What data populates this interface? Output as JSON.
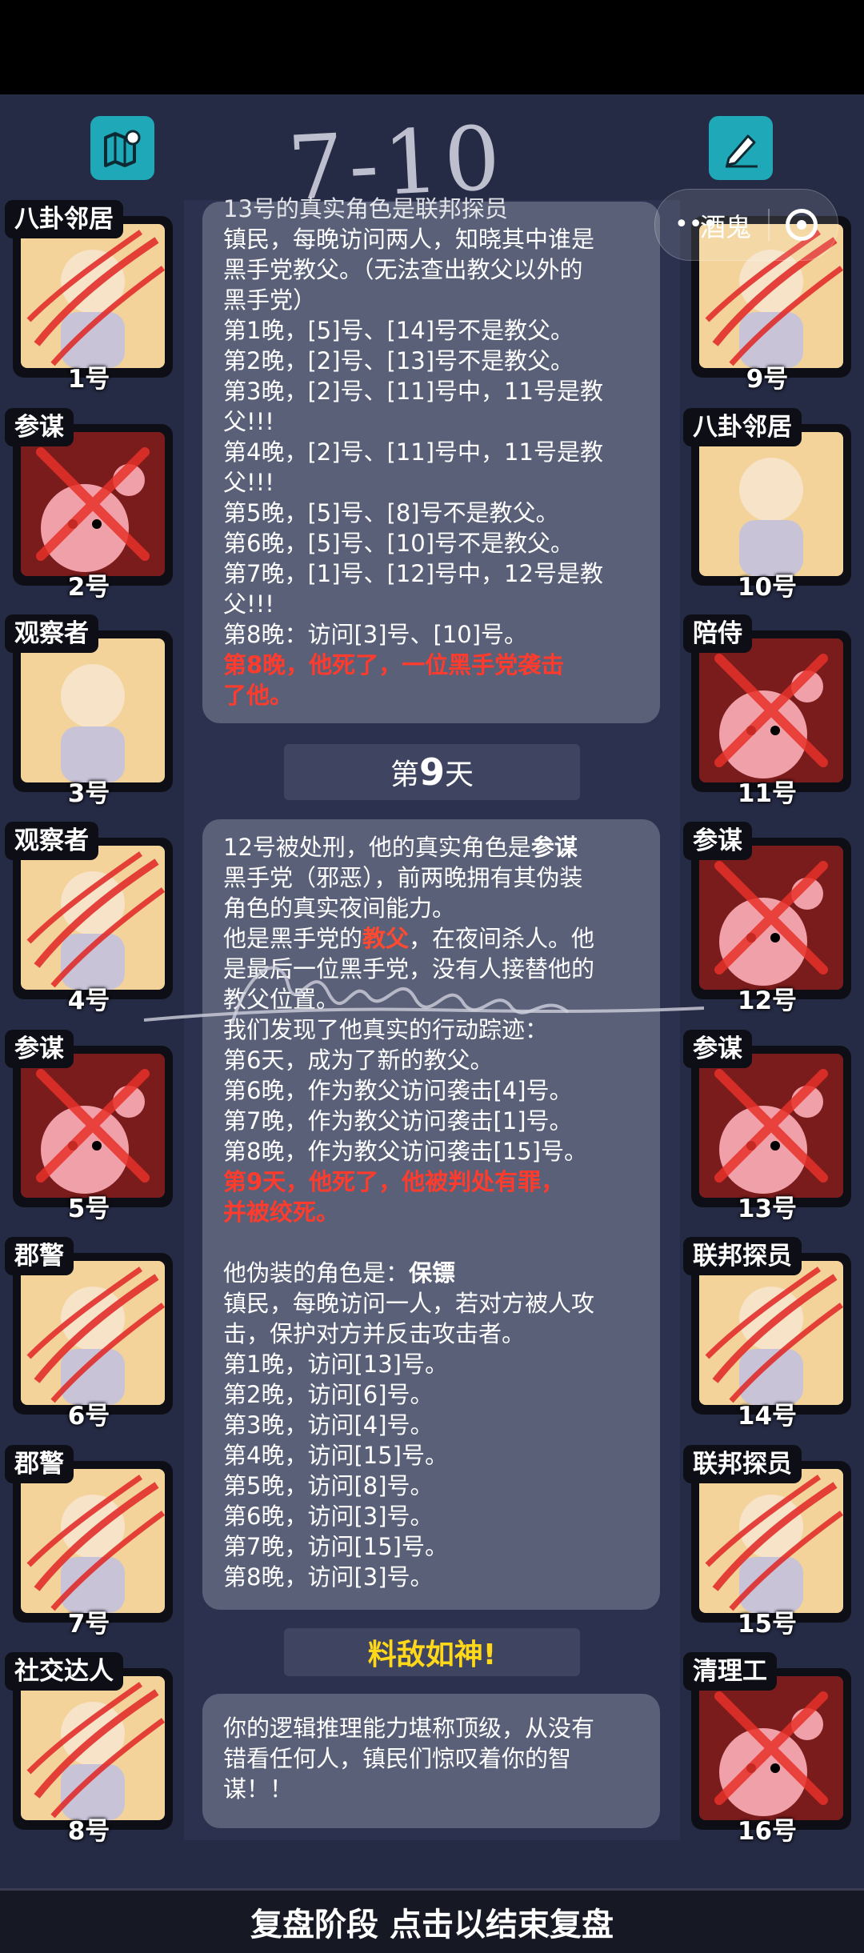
{
  "handwriting": "7-10",
  "mini_program": {
    "label": "酒鬼"
  },
  "icons": {
    "left": "map-icon",
    "right": "pencil-note-icon"
  },
  "players_left": [
    {
      "role": "八卦邻居",
      "num": "1号",
      "dead": true,
      "dark": false
    },
    {
      "role": "参谋",
      "num": "2号",
      "dead": true,
      "dark": true
    },
    {
      "role": "观察者",
      "num": "3号",
      "dead": false,
      "dark": false
    },
    {
      "role": "观察者",
      "num": "4号",
      "dead": true,
      "dark": false
    },
    {
      "role": "参谋",
      "num": "5号",
      "dead": true,
      "dark": true
    },
    {
      "role": "郡警",
      "num": "6号",
      "dead": true,
      "dark": false
    },
    {
      "role": "郡警",
      "num": "7号",
      "dead": true,
      "dark": false
    },
    {
      "role": "社交达人",
      "num": "8号",
      "dead": true,
      "dark": false
    }
  ],
  "players_right": [
    {
      "role": "",
      "num": "9号",
      "dead": true,
      "dark": false
    },
    {
      "role": "八卦邻居",
      "num": "10号",
      "dead": false,
      "dark": false
    },
    {
      "role": "陪侍",
      "num": "11号",
      "dead": true,
      "dark": true
    },
    {
      "role": "参谋",
      "num": "12号",
      "dead": true,
      "dark": true
    },
    {
      "role": "参谋",
      "num": "13号",
      "dead": true,
      "dark": true
    },
    {
      "role": "联邦探员",
      "num": "14号",
      "dead": true,
      "dark": false
    },
    {
      "role": "联邦探员",
      "num": "15号",
      "dead": true,
      "dark": false
    },
    {
      "role": "清理工",
      "num": "16号",
      "dead": true,
      "dark": true
    }
  ],
  "card1": {
    "lines": [
      "13号的真实角色是联邦探员",
      "镇民，每晚访问两人，知晓其中谁是",
      "黑手党教父。（无法查出教父以外的",
      "黑手党）",
      "第1晚，[5]号、[14]号不是教父。",
      "第2晚，[2]号、[13]号不是教父。",
      "第3晚，[2]号、[11]号中，11号是教",
      "父!!!",
      "第4晚，[2]号、[11]号中，11号是教",
      "父!!!",
      "第5晚，[5]号、[8]号不是教父。",
      "第6晚，[5]号、[10]号不是教父。",
      "第7晚，[1]号、[12]号中，12号是教",
      "父!!!",
      "第8晚：访问[3]号、[10]号。"
    ],
    "red_lines": [
      "第8晚，他死了，一位黑手党袭击",
      "了他。"
    ]
  },
  "day9": {
    "prefix": "第",
    "num": "9",
    "suffix": "天"
  },
  "card2": {
    "head1_a": "12号被处刑，他的真实角色是",
    "head1_b": "参谋",
    "l2": "黑手党（邪恶），前两晚拥有其伪装",
    "l3": "角色的真实夜间能力。",
    "l4_a": "他是黑手党的",
    "l4_b": "教父",
    "l4_c": "，在夜间杀人。他",
    "l5": "是最后一位黑手党，没有人接替他的",
    "l6": "教父位置。",
    "l7": "我们发现了他真实的行动踪迹：",
    "l8": "第6天，成为了新的教父。",
    "l9": "第6晚，作为教父访问袭击[4]号。",
    "l10": "第7晚，作为教父访问袭击[1]号。",
    "l11": "第8晚，作为教父访问袭击[15]号。",
    "red1": "第9天，他死了，他被判处有罪，",
    "red2": "并被绞死。",
    "disguise_a": "他伪装的角色是：",
    "disguise_b": "保镖",
    "d1": "镇民，每晚访问一人，若对方被人攻",
    "d2": "击，保护对方并反击攻击者。",
    "nights": [
      "第1晚，访问[13]号。",
      "第2晚，访问[6]号。",
      "第3晚，访问[4]号。",
      "第4晚，访问[15]号。",
      "第5晚，访问[8]号。",
      "第6晚，访问[3]号。",
      "第7晚，访问[15]号。",
      "第8晚，访问[3]号。"
    ]
  },
  "achievement": "料敌如神!",
  "card3": {
    "l1": "你的逻辑推理能力堪称顶级，从没有",
    "l2": "错看任何人，镇民们惊叹着你的智",
    "l3": "谋！！"
  },
  "bottom_bar": "复盘阶段 点击以结束复盘",
  "colors": {
    "accent_red": "#ff3b2d",
    "gold": "#ffd81a",
    "icon_teal": "#1fa8b8",
    "card": "#5a6078"
  }
}
